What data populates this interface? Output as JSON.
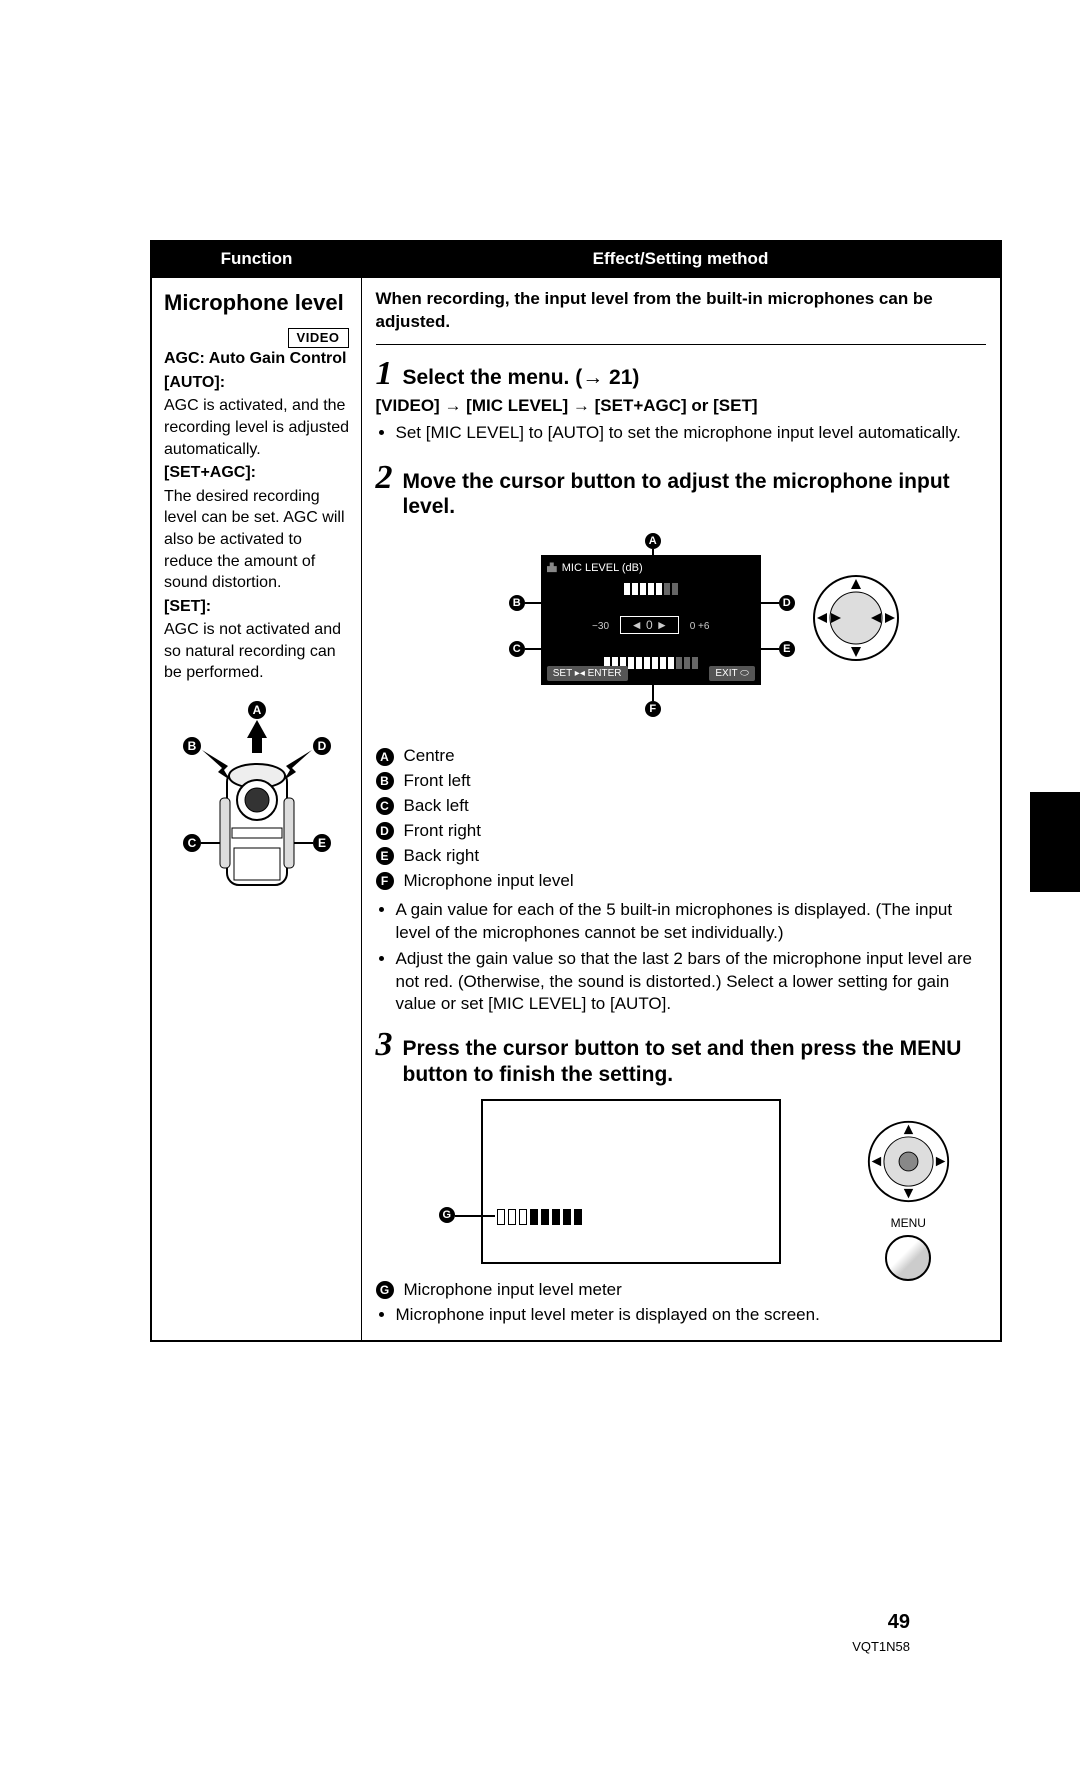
{
  "table": {
    "header": {
      "function": "Function",
      "effect": "Effect/Setting method"
    }
  },
  "function": {
    "title": "Microphone level",
    "video_tag": "VIDEO",
    "agc_heading": "AGC: Auto Gain Control",
    "auto_label": "[AUTO]:",
    "auto_desc": "AGC is activated, and the recording level is adjusted automatically.",
    "setagc_label": "[SET+AGC]:",
    "setagc_desc": "The desired recording level can be set. AGC will also be activated to reduce the amount of sound distortion.",
    "set_label": "[SET]:",
    "set_desc": "AGC is not activated and so natural recording can be performed."
  },
  "effect": {
    "intro": "When recording, the input level from the built-in microphones can be adjusted.",
    "step1": {
      "num": "1",
      "title": "Select the menu. (→ 21)"
    },
    "menupath": "[VIDEO] → [MIC LEVEL] → [SET+AGC] or [SET]",
    "step1_bullet": "Set [MIC LEVEL] to [AUTO] to set the microphone input level automatically.",
    "step2": {
      "num": "2",
      "title": "Move the cursor button to adjust the microphone input level."
    },
    "mic_screen": {
      "title": "MIC LEVEL (dB)",
      "scale_lo": "−30",
      "scale_hi": "0 +6",
      "gain_val": "0",
      "set_enter": "SET ▸◂ ENTER",
      "exit": "EXIT"
    },
    "labels": {
      "A": "A",
      "B": "B",
      "C": "C",
      "D": "D",
      "E": "E",
      "F": "F",
      "G": "G"
    },
    "legend": {
      "A": "Centre",
      "B": "Front left",
      "C": "Back left",
      "D": "Front right",
      "E": "Back right",
      "F": "Microphone input level"
    },
    "step2_bullets": [
      "A gain value for each of the 5 built-in microphones is displayed. (The input level of the microphones cannot be set individually.)",
      "Adjust the gain value so that the last 2 bars of the microphone input level are not red. (Otherwise, the sound is distorted.) Select a lower setting for gain value or set [MIC LEVEL] to [AUTO]."
    ],
    "step3": {
      "num": "3",
      "title": "Press the cursor button to set and then press the MENU button to finish the setting."
    },
    "menu_label": "MENU",
    "legendG": "Microphone input level meter",
    "final_bullet": "Microphone input level meter is displayed on the screen."
  },
  "footer": {
    "page": "49",
    "code": "VQT1N58"
  }
}
